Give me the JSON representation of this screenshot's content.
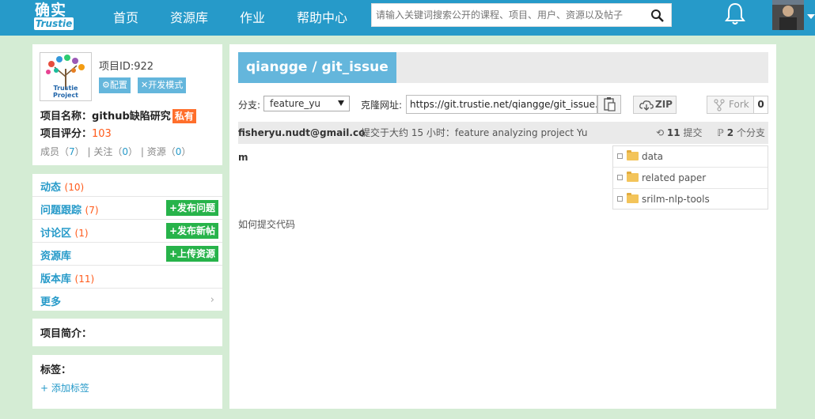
{
  "header": {
    "logo_top": "确实",
    "logo_bottom": "Trustie",
    "nav": [
      "首页",
      "资源库",
      "作业",
      "帮助中心"
    ],
    "search_placeholder": "请输入关键词搜索公开的课程、项目、用户、资源以及帖子",
    "colors": {
      "bar": "#269ac9"
    }
  },
  "project": {
    "logo_caption": "Trustie Project",
    "id_label": "项目ID:922",
    "config_label": "配置",
    "devmode_label": "开发模式",
    "name_label": "项目名称：",
    "name_value": "github缺陷研究",
    "private_badge": "私有",
    "score_label": "项目评分：",
    "score_value": "103",
    "members_label": "成员（",
    "members_count": "7",
    "follow_label": "关注（",
    "follow_count": "0",
    "resources_label": "资源（",
    "resources_count": "0"
  },
  "menu": {
    "items": [
      {
        "label": "动态",
        "count": "(10)",
        "button": ""
      },
      {
        "label": "问题跟踪",
        "count": "(7)",
        "button": "+发布问题"
      },
      {
        "label": "讨论区",
        "count": "(1)",
        "button": "+发布新帖"
      },
      {
        "label": "资源库",
        "count": "",
        "button": "+上传资源"
      },
      {
        "label": "版本库",
        "count": "(11)",
        "button": ""
      },
      {
        "label": "更多",
        "count": "",
        "button": ""
      }
    ]
  },
  "intro": {
    "title": "项目简介："
  },
  "tags": {
    "title": "标签：",
    "add_label": "+ 添加标签"
  },
  "repo": {
    "title": "qiangge / git_issue",
    "branch_label": "分支:",
    "branch_value": "feature_yu",
    "clone_label": "克隆网址:",
    "clone_url": "https://git.trustie.net/qiangge/git_issue.git",
    "zip_label": "ZIP",
    "fork_label": "Fork",
    "fork_count": "0",
    "commit_email": "fisheryu.nudt@gmail.co",
    "commit_message": "提交于大约 15 小时：feature analyzing project Yu",
    "commits_count": "11",
    "commits_label": "提交",
    "branches_count": "2",
    "branches_label": "个分支",
    "file_m": "m",
    "files": [
      "data",
      "related paper",
      "srilm-nlp-tools"
    ],
    "readme": "如何提交代码"
  }
}
